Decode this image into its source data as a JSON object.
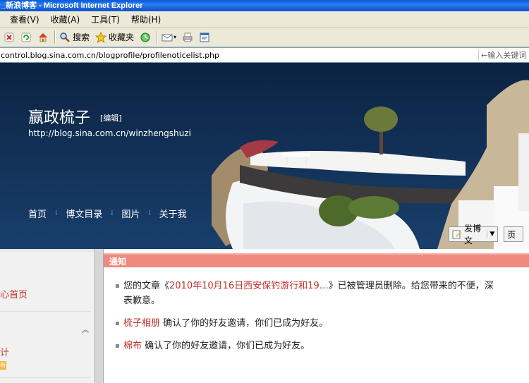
{
  "window": {
    "title": "_新浪博客 - Microsoft Internet Explorer"
  },
  "menu": [
    "查看(V)",
    "收藏(A)",
    "工具(T)",
    "帮助(H)"
  ],
  "toolbar": {
    "search_label": "搜索",
    "favorites_label": "收藏夹",
    "icons": [
      "stop-icon",
      "refresh-icon",
      "home-icon",
      "search-icon",
      "favorites-icon",
      "history-icon",
      "mail-icon",
      "print-icon",
      "edit-icon"
    ]
  },
  "address": {
    "url": "control.blog.sina.com.cn/blogprofile/profilenoticelist.php",
    "search_placeholder": "←输入关键词"
  },
  "blog": {
    "title": "赢政梳子",
    "edit_label": "[编辑]",
    "url": "http://blog.sina.com.cn/winzhengshuzi",
    "nav": [
      "首页",
      "博文目录",
      "图片",
      "关于我"
    ],
    "post_button": "发博文",
    "page_button": "页"
  },
  "sidebar": {
    "items": [
      "心首页",
      "计"
    ],
    "badge": "新"
  },
  "notice": {
    "header": "通知",
    "items": [
      {
        "prefix": "您的文章《",
        "link": "2010年10月16日西安保钓游行和19…",
        "suffix": "》已被管理员删除。给您带来的不便，深表歉意。"
      },
      {
        "prefix": "",
        "link": "梳子相册",
        "suffix": " 确认了你的好友邀请，你们已成为好友。"
      },
      {
        "prefix": "",
        "link": "棉布",
        "suffix": " 确认了你的好友邀请，你们已成为好友。"
      }
    ]
  },
  "colors": {
    "accent": "#c0302a",
    "notice_header": "#f08a80",
    "titlebar": "#0a5bd8"
  }
}
